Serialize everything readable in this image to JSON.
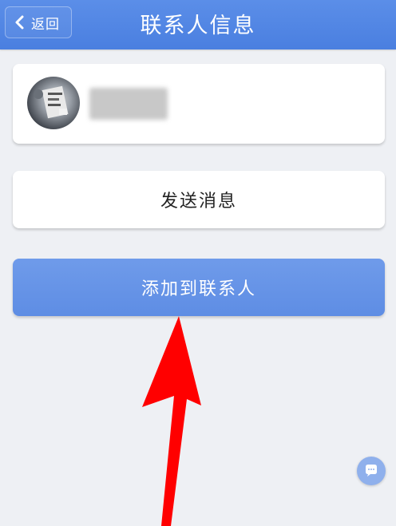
{
  "header": {
    "back_label": "返回",
    "title": "联系人信息"
  },
  "contact": {
    "avatar_icon": "avatar-image",
    "name_redacted": true
  },
  "actions": {
    "send_message": "发送消息",
    "add_to_contacts": "添加到联系人"
  },
  "floating": {
    "icon": "chat-bubble-icon"
  },
  "colors": {
    "header": "#4a7fe0",
    "primary_button": "#5e8de4",
    "background": "#eef0f4",
    "annotation_arrow": "#ff0000"
  }
}
